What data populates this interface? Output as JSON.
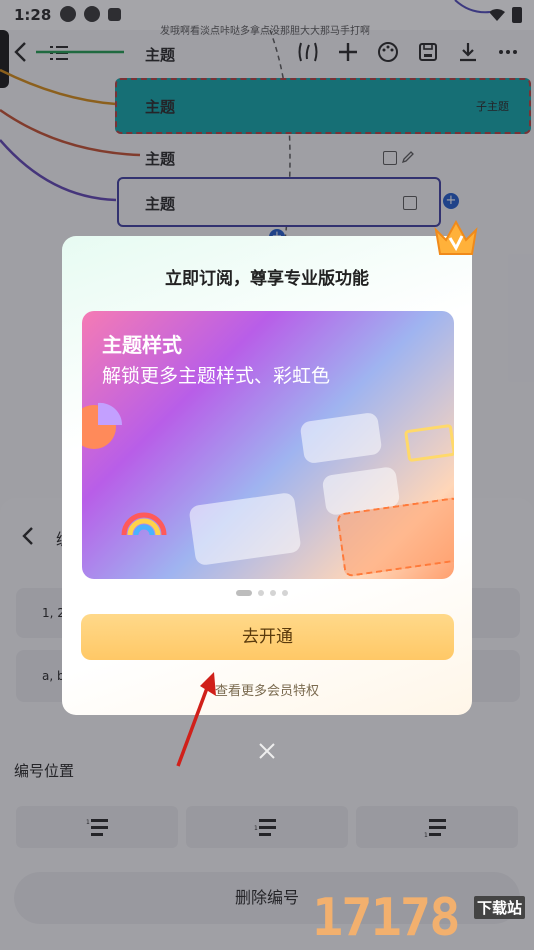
{
  "status_bar": {
    "time": "1:28",
    "notice": "发哦啊看淡点咔哒多拿点没那胆大大那马手打啊"
  },
  "mindmap": {
    "nodes": [
      "主题",
      "主题",
      "主题",
      "主题"
    ],
    "subtopic": "子主题",
    "colors": {
      "selected_fill": "#0aa3a5",
      "selected_border": "#b43a3a",
      "outline": "#3a3a9e"
    }
  },
  "panel": {
    "title_partial": "编",
    "options": [
      "1, 2",
      "a, b"
    ],
    "number_position_label": "编号位置",
    "delete_label": "删除编号"
  },
  "modal": {
    "title": "立即订阅，尊享专业版功能",
    "banner_title": "主题样式",
    "banner_subtitle": "解锁更多主题样式、彩虹色",
    "cta_label": "去开通",
    "more_label": "查看更多会员特权",
    "pager_count": 4,
    "pager_active": 0
  },
  "watermark": {
    "number": "17178",
    "site": "下载站"
  }
}
